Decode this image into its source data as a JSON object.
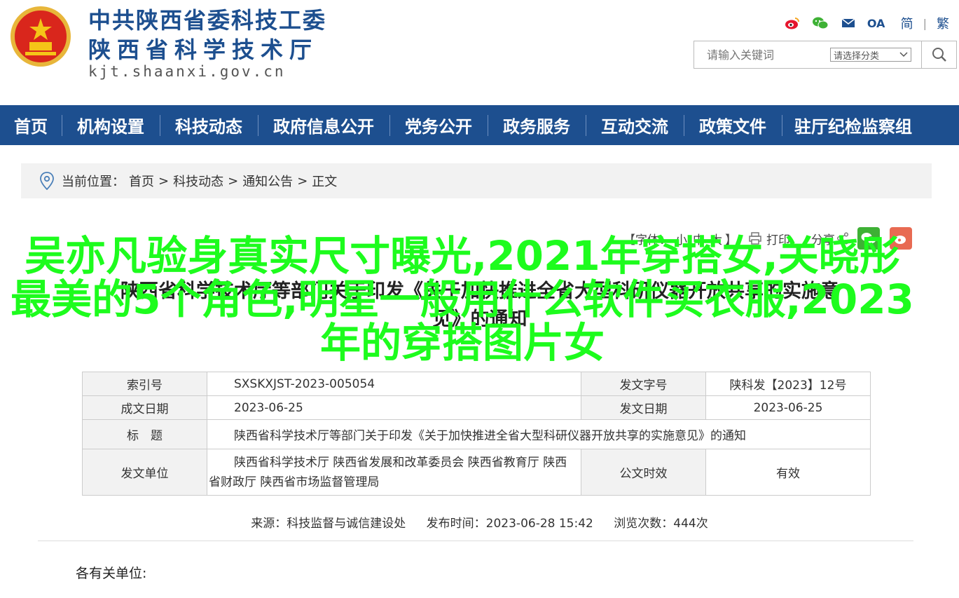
{
  "header": {
    "title_line1": "中共陕西省委科技工委",
    "title_line2": "陕西省科学技术厅",
    "domain": "kjt.shaanxi.gov.cn",
    "lang_simplified": "简",
    "lang_traditional": "繁",
    "lang_separator": "|",
    "oa_label": "OA"
  },
  "search": {
    "placeholder": "请输入关键词",
    "category_label": "请选择分类"
  },
  "nav": {
    "items": [
      "首页",
      "机构设置",
      "科技动态",
      "政府信息公开",
      "党务公开",
      "政务服务",
      "互动交流",
      "政策文件",
      "驻厅纪检监察组"
    ]
  },
  "breadcrumb": {
    "prefix": "当前位置：",
    "items": [
      "首页",
      "科技动态",
      "通知公告",
      "正文"
    ],
    "separator": ">"
  },
  "tools": {
    "font_label": "【字体：",
    "font_small": "小",
    "font_medium": "中",
    "font_large": "大",
    "font_close": "】",
    "print_label": "打印",
    "share_label": "分享"
  },
  "document": {
    "title_line1": "陕西省科学技术厅等部门关于印发《关于加快推进全省大型科研仪器开放共享的实施意",
    "title_line2": "见》的通知"
  },
  "overlay": {
    "text": "吴亦凡验身真实尺寸曝光,2021年穿搭女,关晓彤最美的5个角色,明星一般用什么软件买衣服,2023年的穿搭图片女"
  },
  "meta": {
    "index_label": "索引号",
    "index_value": "SXSKXJST-2023-005054",
    "docno_label": "发文字号",
    "docno_value": "陕科发【2023】12号",
    "created_label": "成文日期",
    "created_value": "2023-06-25",
    "issued_label": "发文日期",
    "issued_value": "2023-06-25",
    "subject_label": "标　题",
    "subject_value": "陕西省科学技术厅等部门关于印发《关于加快推进全省大型科研仪器开放共享的实施意见》的通知",
    "unit_label": "发文单位",
    "unit_value": "陕西省科学技术厅 陕西省发展和改革委员会 陕西省教育厅 陕西省财政厅 陕西省市场监督管理局",
    "validity_label": "公文时效",
    "validity_value": "有效"
  },
  "source": {
    "from": "来源：科技监督与诚信建设处",
    "published": "发布时间：2023-06-28 15:42",
    "views": "浏览次数：444次"
  },
  "body": {
    "salutation": "各有关单位:"
  },
  "colors": {
    "brand_blue": "#1d4f8f",
    "overlay_green": "#1dfc1d",
    "emblem_red": "#d9261c",
    "wechat_green": "#3eb135",
    "weibo_red": "#e86a52"
  }
}
